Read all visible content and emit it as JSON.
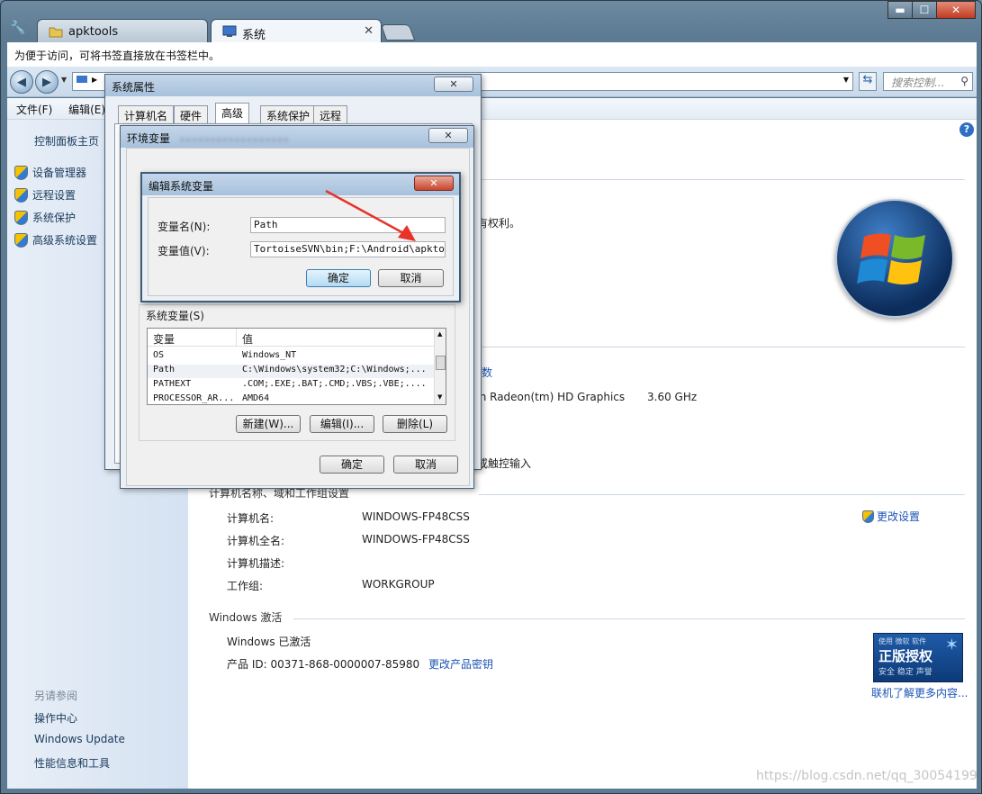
{
  "browser": {
    "tabs": [
      {
        "label": "apktools"
      },
      {
        "label": "系统"
      }
    ],
    "bookmark_bar_text": "为便于访问，可将书签直接放在书签栏中。",
    "search_placeholder": "搜索控制...",
    "window_buttons": {
      "minimize": "▬",
      "maximize": "☐",
      "close": "✕"
    }
  },
  "menu": {
    "file": "文件(F)",
    "edit": "编辑(E)"
  },
  "sidebar": {
    "home": "控制面板主页",
    "items": [
      {
        "label": "设备管理器"
      },
      {
        "label": "远程设置"
      },
      {
        "label": "系统保护"
      },
      {
        "label": "高级系统设置"
      }
    ],
    "see_also_title": "另请参阅",
    "see_also": [
      {
        "label": "操作中心"
      },
      {
        "label": "Windows Update"
      },
      {
        "label": "性能信息和工具"
      }
    ]
  },
  "main": {
    "rights_fragment": "有权利。",
    "fragment_link": "数",
    "processor_fragment": "th Radeon(tm) HD Graphics",
    "processor_speed": "3.60 GHz",
    "pen_fragment": "或触控输入",
    "computer_section_title": "计算机名称、域和工作组设置",
    "rows": [
      {
        "label": "计算机名:",
        "value": "WINDOWS-FP48CSS"
      },
      {
        "label": "计算机全名:",
        "value": "WINDOWS-FP48CSS"
      },
      {
        "label": "计算机描述:",
        "value": ""
      },
      {
        "label": "工作组:",
        "value": "WORKGROUP"
      }
    ],
    "change_settings": "更改设置",
    "activation_title": "Windows 激活",
    "activated": "Windows 已激活",
    "product_id": "产品 ID: 00371-868-0000007-85980",
    "change_key": "更改产品密钥",
    "genuine_top": "使用 微软 软件",
    "genuine_main": "正版授权",
    "genuine_sub": "安全 稳定 声誉",
    "learn_more": "联机了解更多内容..."
  },
  "sys_props": {
    "title": "系统属性",
    "tabs": [
      "计算机名",
      "硬件",
      "高级",
      "系统保护",
      "远程"
    ],
    "active_tab": "高级"
  },
  "env_vars": {
    "title": "环境变量",
    "system_vars_label": "系统变量(S)",
    "columns": [
      "变量",
      "值"
    ],
    "rows": [
      {
        "name": "OS",
        "value": "Windows_NT"
      },
      {
        "name": "Path",
        "value": "C:\\Windows\\system32;C:\\Windows;..."
      },
      {
        "name": "PATHEXT",
        "value": ".COM;.EXE;.BAT;.CMD;.VBS;.VBE;...."
      },
      {
        "name": "PROCESSOR_AR...",
        "value": "AMD64"
      }
    ],
    "new_btn": "新建(W)...",
    "edit_btn": "编辑(I)...",
    "delete_btn": "删除(L)",
    "ok": "确定",
    "cancel": "取消"
  },
  "edit_var": {
    "title": "编辑系统变量",
    "name_label": "变量名(N):",
    "name_value": "Path",
    "value_label": "变量值(V):",
    "value_value": "TortoiseSVN\\bin;F:\\Android\\apktools",
    "ok": "确定",
    "cancel": "取消"
  },
  "watermark": "https://blog.csdn.net/qq_30054199",
  "colors": {
    "link": "#1a54b6",
    "arrow": "#e8322a",
    "accent": "#3c7fb1"
  }
}
